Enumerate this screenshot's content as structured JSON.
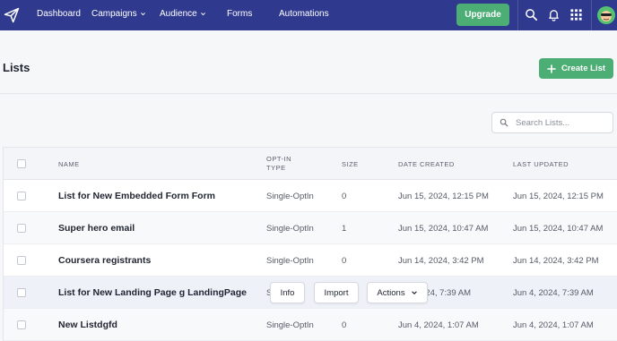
{
  "nav": {
    "items": [
      {
        "label": "Dashboard"
      },
      {
        "label": "Campaigns"
      },
      {
        "label": "Audience"
      },
      {
        "label": "Forms"
      },
      {
        "label": "Automations"
      }
    ],
    "upgrade_label": "Upgrade"
  },
  "page": {
    "title": "Lists",
    "create_label": "Create List"
  },
  "search": {
    "placeholder": "Search Lists..."
  },
  "table": {
    "columns": [
      "NAME",
      "OPT-IN TYPE",
      "SIZE",
      "DATE CREATED",
      "LAST UPDATED"
    ],
    "columns_split": {
      "optin_line1": "OPT-IN",
      "optin_line2": "TYPE"
    },
    "rows": [
      {
        "name": "List for New Embedded Form Form",
        "optin": "Single-OptIn",
        "size": "0",
        "created": "Jun 15, 2024, 12:15 PM",
        "updated": "Jun 15, 2024, 12:15 PM"
      },
      {
        "name": "Super hero email",
        "optin": "Single-OptIn",
        "size": "1",
        "created": "Jun 15, 2024, 10:47 AM",
        "updated": "Jun 15, 2024, 10:47 AM"
      },
      {
        "name": "Coursera registrants",
        "optin": "Single-OptIn",
        "size": "0",
        "created": "Jun 14, 2024, 3:42 PM",
        "updated": "Jun 14, 2024, 3:42 PM"
      },
      {
        "name": "List for New Landing Page g LandingPage",
        "optin": "Single-OptIn",
        "size": "0",
        "created": "Jun 4, 2024, 7:39 AM",
        "updated": "Jun 4, 2024, 7:39 AM",
        "optin_visible": "S",
        "created_visible": "024, 7:39 AM"
      },
      {
        "name": "New Listdgfd",
        "optin": "Single-OptIn",
        "size": "0",
        "created": "Jun 4, 2024, 1:07 AM",
        "updated": "Jun 4, 2024, 1:07 AM"
      }
    ]
  },
  "row_actions": {
    "info": "Info",
    "import": "Import",
    "actions": "Actions"
  },
  "colors": {
    "nav_bg": "#2f3a8f",
    "accent": "#4cae75"
  }
}
